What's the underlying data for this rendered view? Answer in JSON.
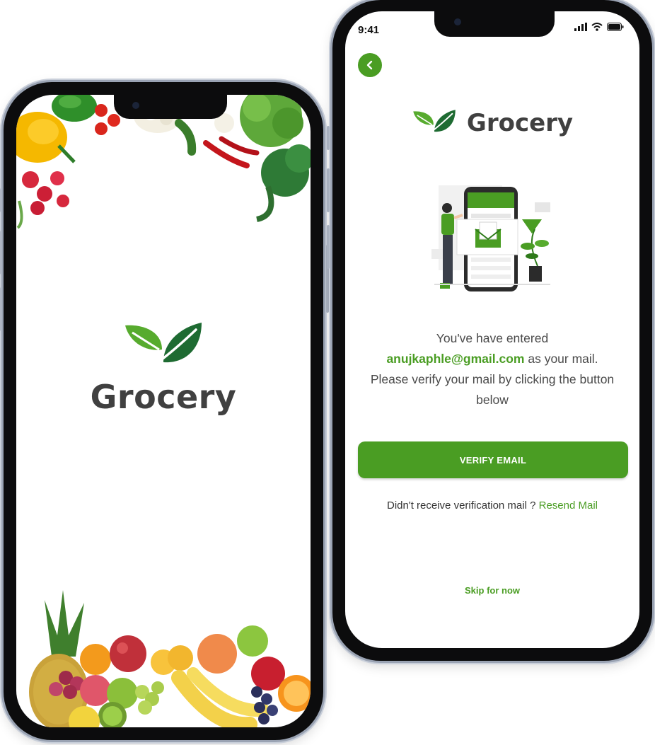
{
  "colors": {
    "brand_green": "#4a9d23",
    "leaf_dark": "#1e6b32",
    "leaf_light": "#57ab2e",
    "text_dark": "#404040"
  },
  "splash": {
    "app_name": "Grocery",
    "logo_icon": "leaf-logo-icon"
  },
  "verify": {
    "status_bar": {
      "time": "9:41",
      "icons": [
        "signal-icon",
        "wifi-icon",
        "battery-icon"
      ]
    },
    "back_icon": "chevron-left-icon",
    "app_name": "Grocery",
    "illustration": "email-verification-illustration",
    "message_line1": "You've have entered",
    "email": "anujkaphle@gmail.com",
    "message_line2_suffix": " as your mail.",
    "message_line3": "Please verify your mail by clicking the button below",
    "verify_button": "VERIFY EMAIL",
    "resend_prompt": "Didn't receive verification mail ? ",
    "resend_link": "Resend Mail",
    "skip_link": "Skip for now"
  }
}
